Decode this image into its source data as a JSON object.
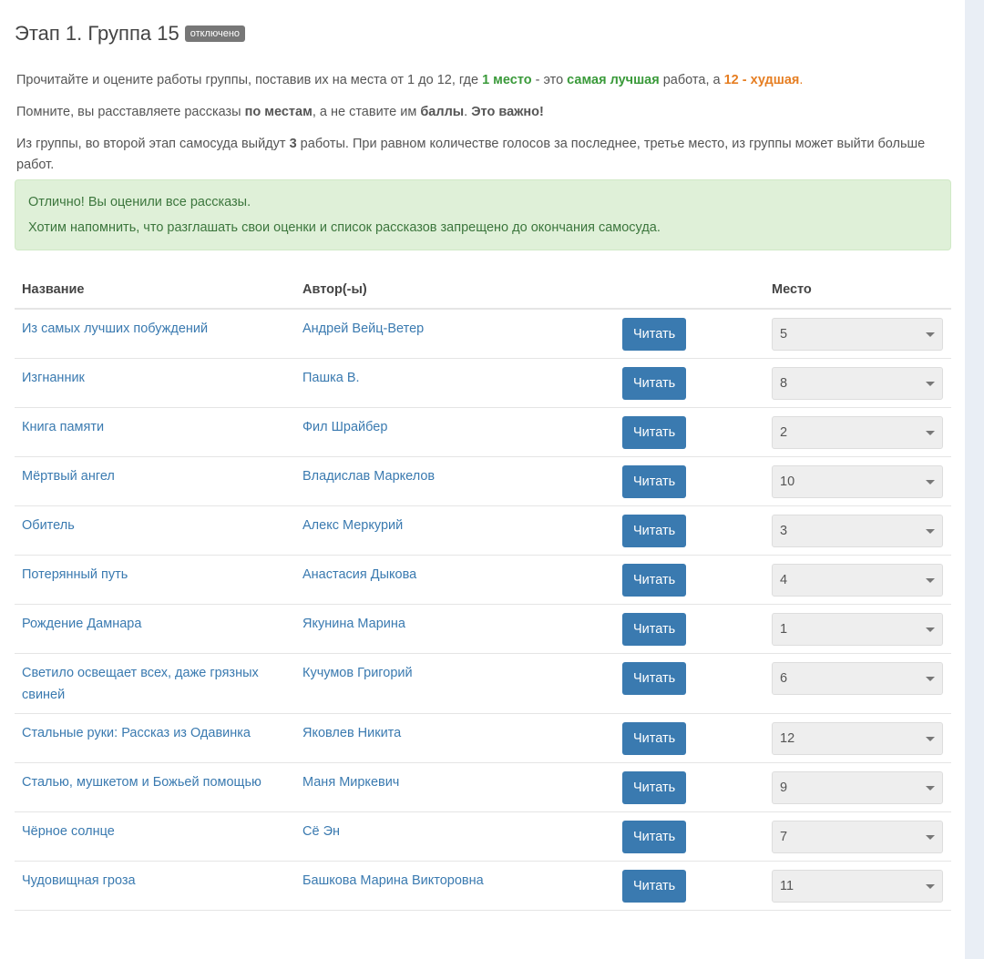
{
  "title": "Этап 1. Группа 15",
  "badge": "отключено",
  "intro": {
    "a": "Прочитайте и оцените работы группы, поставив их на места от 1 до 12, где ",
    "b": "1 место",
    "c": " - это ",
    "d": "самая лучшая",
    "e": " работа, а ",
    "f": "12 - худшая",
    "g": "."
  },
  "remind": {
    "a": "Помните, вы расставляете рассказы ",
    "b": "по местам",
    "c": ", а не ставите им ",
    "d": "баллы",
    "e": ". ",
    "f": "Это важно!"
  },
  "info": {
    "a": "Из группы, во второй этап самосуда выйдут ",
    "b": "3",
    "c": " работы. При равном количестве голосов за последнее, третье место, из группы может выйти больше работ."
  },
  "alert": {
    "line1": "Отлично! Вы оценили все рассказы.",
    "line2": "Хотим напомнить, что разглашать свои оценки и список рассказов запрещено до окончания самосуда."
  },
  "table": {
    "headers": {
      "name": "Название",
      "author": "Автор(-ы)",
      "place": "Место"
    },
    "read_label": "Читать",
    "rows": [
      {
        "name": "Из самых лучших побуждений",
        "author": "Андрей Вейц-Ветер",
        "place": "5"
      },
      {
        "name": "Изгнанник",
        "author": "Пашка В.",
        "place": "8"
      },
      {
        "name": "Книга памяти",
        "author": "Фил Шрайбер",
        "place": "2"
      },
      {
        "name": "Мёртвый ангел",
        "author": "Владислав Маркелов",
        "place": "10"
      },
      {
        "name": "Обитель",
        "author": "Алекс Меркурий",
        "place": "3"
      },
      {
        "name": "Потерянный путь",
        "author": "Анастасия Дыкова",
        "place": "4"
      },
      {
        "name": "Рождение Дамнара",
        "author": "Якунина Марина",
        "place": "1"
      },
      {
        "name": "Светило освещает всех, даже грязных свиней",
        "author": "Кучумов Григорий",
        "place": "6"
      },
      {
        "name": "Стальные руки: Рассказ из Одавинка",
        "author": "Яковлев Никита",
        "place": "12"
      },
      {
        "name": "Сталью, мушкетом и Божьей помощью",
        "author": "Маня Миркевич",
        "place": "9"
      },
      {
        "name": "Чёрное солнце",
        "author": "Сё Эн",
        "place": "7"
      },
      {
        "name": "Чудовищная гроза",
        "author": "Башкова Марина Викторовна",
        "place": "11"
      }
    ]
  }
}
